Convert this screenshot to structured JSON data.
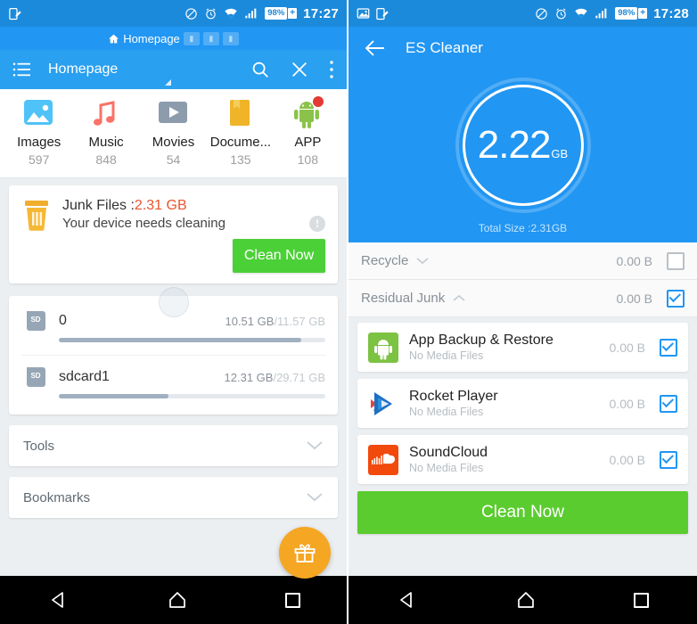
{
  "left": {
    "status_bar": {
      "time": "17:27",
      "battery_percent": "98%",
      "charging_glyph": "+",
      "icons": [
        "note-edit-icon",
        "do-not-disturb-icon",
        "alarm-icon",
        "wifi-icon",
        "signal-icon",
        "battery-icon"
      ]
    },
    "tabstrip": {
      "active_tab": "Homepage",
      "home_icon": "home-icon",
      "ghost_tabs": [
        "chat-tab-icon",
        "app-tab-icon",
        "window-tab-icon"
      ]
    },
    "toolbar": {
      "menu_icon": "hamburger-list-icon",
      "title": "Homepage",
      "search_icon": "search-icon",
      "close_icon": "close-icon",
      "overflow_icon": "more-vertical-icon"
    },
    "categories": [
      {
        "label": "Images",
        "count": "597",
        "icon": "image-icon",
        "badge": false
      },
      {
        "label": "Music",
        "count": "848",
        "icon": "music-note-icon",
        "badge": false
      },
      {
        "label": "Movies",
        "count": "54",
        "icon": "video-play-icon",
        "badge": false
      },
      {
        "label": "Docume...",
        "count": "135",
        "icon": "document-icon",
        "badge": false
      },
      {
        "label": "APP",
        "count": "108",
        "icon": "android-icon",
        "badge": true
      }
    ],
    "junk_card": {
      "trash_icon": "trash-icon",
      "title_prefix": "Junk Files :",
      "amount": "2.31 GB",
      "subtitle": "Your device needs cleaning",
      "info_icon": "info-icon",
      "info_glyph": "!",
      "clean_button": "Clean Now"
    },
    "storage": [
      {
        "icon": "sd-card-icon",
        "name": "0",
        "used": "10.51 GB",
        "capacity": "/11.57 GB",
        "percent": 91
      },
      {
        "icon": "sd-card-icon",
        "name": "sdcard1",
        "used": "12.31 GB",
        "capacity": "/29.71 GB",
        "percent": 41
      }
    ],
    "sections": [
      {
        "label": "Tools",
        "chevron": "chevron-down-icon"
      },
      {
        "label": "Bookmarks",
        "chevron": "chevron-down-icon"
      }
    ],
    "fab": {
      "icon": "gift-icon"
    }
  },
  "right": {
    "status_bar": {
      "time": "17:28",
      "battery_percent": "98%",
      "charging_glyph": "+",
      "icons": [
        "screenshot-icon",
        "note-edit-icon",
        "do-not-disturb-icon",
        "alarm-icon",
        "wifi-icon",
        "signal-icon",
        "battery-icon"
      ]
    },
    "toolbar": {
      "back_icon": "back-arrow-icon",
      "title": "ES Cleaner"
    },
    "gauge": {
      "value": "2.22",
      "unit": "GB",
      "total_label": "Total Size :2.31GB"
    },
    "groups": [
      {
        "name": "Recycle",
        "arrow": "chevron-down-icon",
        "size": "0.00 B",
        "checked": false
      },
      {
        "name": "Residual Junk",
        "arrow": "chevron-up-icon",
        "size": "0.00 B",
        "checked": true
      }
    ],
    "apps": [
      {
        "name": "App Backup & Restore",
        "sub": "No Media Files",
        "size": "0.00 B",
        "checked": true,
        "icon": "android-app-icon"
      },
      {
        "name": "Rocket Player",
        "sub": "No Media Files",
        "size": "0.00 B",
        "checked": true,
        "icon": "rocket-player-icon"
      },
      {
        "name": "SoundCloud",
        "sub": "No Media Files",
        "size": "0.00 B",
        "checked": true,
        "icon": "soundcloud-icon"
      }
    ],
    "clean_button": "Clean Now"
  },
  "navbar": {
    "back": "back-triangle-icon",
    "home": "home-pentagon-icon",
    "recents": "recents-square-icon"
  },
  "colors": {
    "status_bar_blue": "#1c8adb",
    "toolbar_blue": "#29a0f0",
    "primary_blue": "#2196f3",
    "clean_green": "#4cd038",
    "clean_green_wide": "#5bcc30",
    "junk_amount_orange": "#e8552d",
    "fab_orange": "#f5a623",
    "page_bg": "#eceff1"
  }
}
